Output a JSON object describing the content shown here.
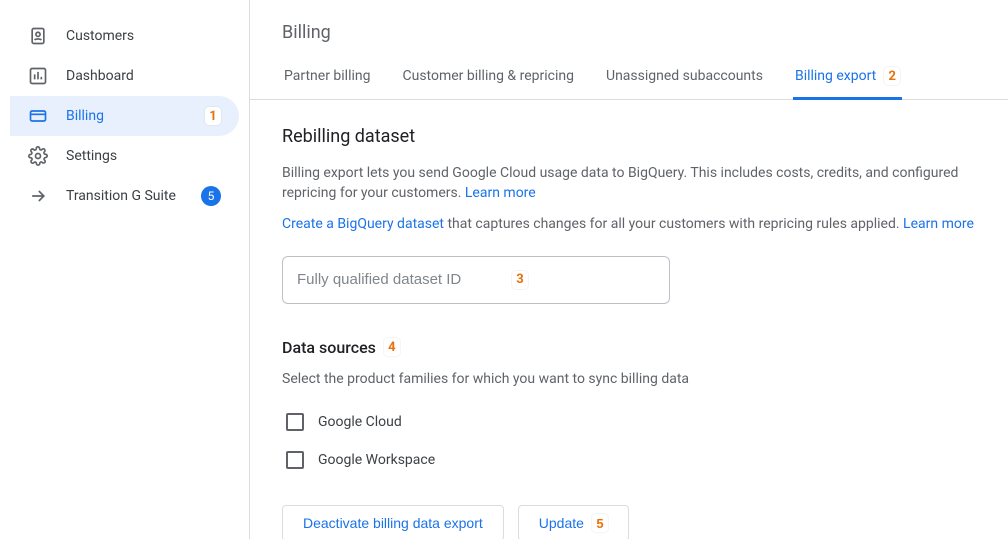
{
  "sidebar": {
    "items": [
      {
        "label": "Customers",
        "icon": "customers-icon"
      },
      {
        "label": "Dashboard",
        "icon": "dashboard-icon"
      },
      {
        "label": "Billing",
        "icon": "billing-icon",
        "active": true,
        "callout": "1"
      },
      {
        "label": "Settings",
        "icon": "settings-icon"
      },
      {
        "label": "Transition G Suite",
        "icon": "arrow-right-icon",
        "badge": "5"
      }
    ]
  },
  "page": {
    "title": "Billing",
    "tabs": [
      {
        "label": "Partner billing"
      },
      {
        "label": "Customer billing & repricing"
      },
      {
        "label": "Unassigned subaccounts"
      },
      {
        "label": "Billing export",
        "active": true,
        "callout": "2"
      }
    ]
  },
  "rebilling": {
    "heading": "Rebilling dataset",
    "desc_pre": "Billing export lets you send Google Cloud usage data to BigQuery. This includes costs, credits, and configured repricing for your customers. ",
    "learn_more": "Learn more",
    "create_link": "Create a BigQuery dataset",
    "create_rest": " that captures changes for all your customers with repricing rules applied. ",
    "input_placeholder": "Fully qualified dataset ID",
    "input_callout": "3"
  },
  "datasources": {
    "heading": "Data sources",
    "heading_callout": "4",
    "subtext": "Select the product families for which you want to sync billing data",
    "options": [
      {
        "label": "Google Cloud",
        "checked": false
      },
      {
        "label": "Google Workspace",
        "checked": false
      }
    ]
  },
  "buttons": {
    "deactivate": "Deactivate billing data export",
    "update": "Update",
    "update_callout": "5"
  }
}
